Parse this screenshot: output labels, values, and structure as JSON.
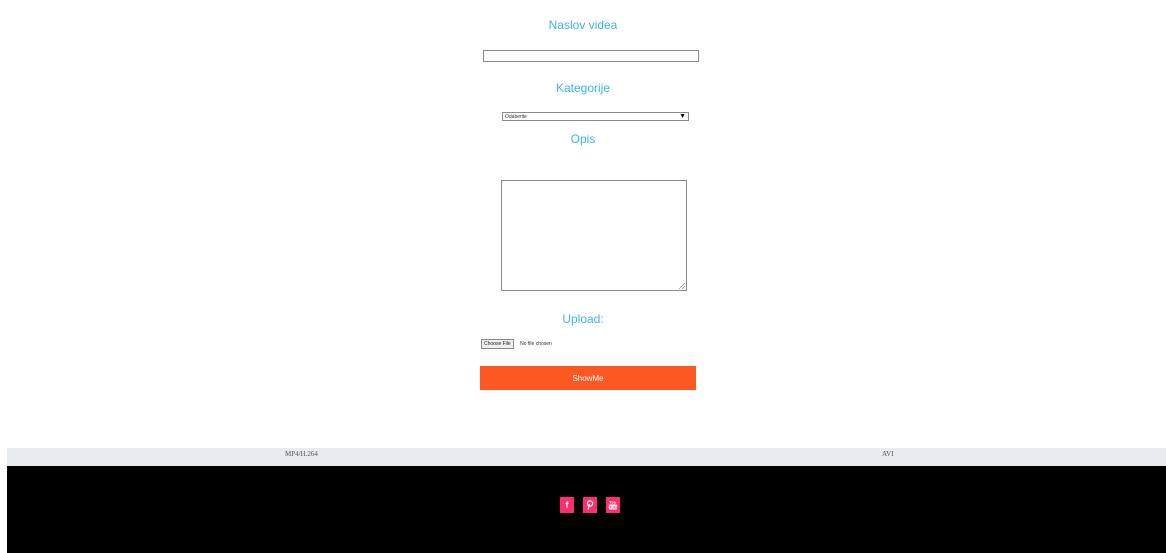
{
  "form": {
    "title_label": "Naslov videa",
    "title_value": "",
    "category_label": "Kategorije",
    "category_selected": "Odaberite",
    "description_label": "Opis",
    "description_value": "",
    "upload_label": "Upload:",
    "file_button": "Choose File",
    "file_status": "No file chosen",
    "submit_label": "ShowMe"
  },
  "formats": [
    "MP4/H.264",
    "AVI"
  ],
  "footer": {
    "social": [
      {
        "icon": "facebook-icon",
        "glyph": "f"
      },
      {
        "icon": "pinterest-icon",
        "glyph": "P"
      },
      {
        "icon": "youtube-icon",
        "glyph": "You"
      }
    ],
    "accent_color": "#ff2d6e",
    "background": "#000000"
  },
  "colors": {
    "label": "#3db4e6",
    "submit": "#fd5722"
  }
}
